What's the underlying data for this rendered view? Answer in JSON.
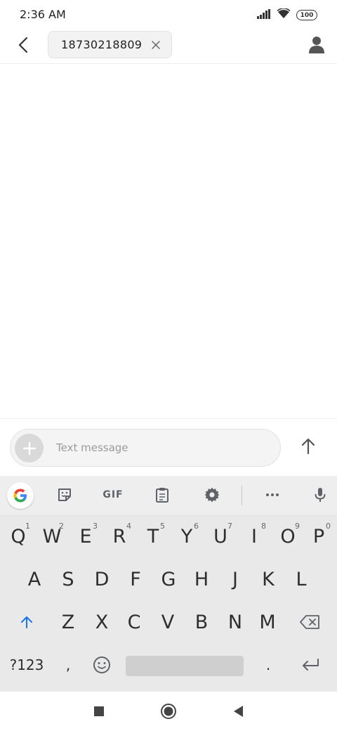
{
  "status_bar": {
    "time": "2:36 AM",
    "battery": "100",
    "icons": [
      "signal-icon",
      "wifi-icon",
      "battery-icon"
    ]
  },
  "header": {
    "recipient": "18730218809",
    "icons": [
      "back-arrow-icon",
      "close-icon",
      "contact-person-icon"
    ]
  },
  "compose": {
    "placeholder": "Text message",
    "value": "",
    "icons": [
      "add-icon",
      "send-arrow-icon"
    ]
  },
  "keyboard": {
    "toolbar": {
      "gif_label": "GIF",
      "icons": [
        "google-g-icon",
        "sticker-icon",
        "gif-icon",
        "clipboard-icon",
        "settings-gear-icon",
        "more-dots-icon",
        "microphone-icon"
      ]
    },
    "row1": [
      {
        "label": "Q",
        "hint": "1"
      },
      {
        "label": "W",
        "hint": "2"
      },
      {
        "label": "E",
        "hint": "3"
      },
      {
        "label": "R",
        "hint": "4"
      },
      {
        "label": "T",
        "hint": "5"
      },
      {
        "label": "Y",
        "hint": "6"
      },
      {
        "label": "U",
        "hint": "7"
      },
      {
        "label": "I",
        "hint": "8"
      },
      {
        "label": "O",
        "hint": "9"
      },
      {
        "label": "P",
        "hint": "0"
      }
    ],
    "row2": [
      "A",
      "S",
      "D",
      "F",
      "G",
      "H",
      "J",
      "K",
      "L"
    ],
    "row3": [
      "Z",
      "X",
      "C",
      "V",
      "B",
      "N",
      "M"
    ],
    "row4": {
      "symbols_label": "?123",
      "comma": ",",
      "period": "."
    },
    "accent_color": "#1a73e8"
  },
  "nav_bar": {
    "icons": [
      "recents-square-icon",
      "home-circle-icon",
      "back-triangle-icon"
    ]
  }
}
